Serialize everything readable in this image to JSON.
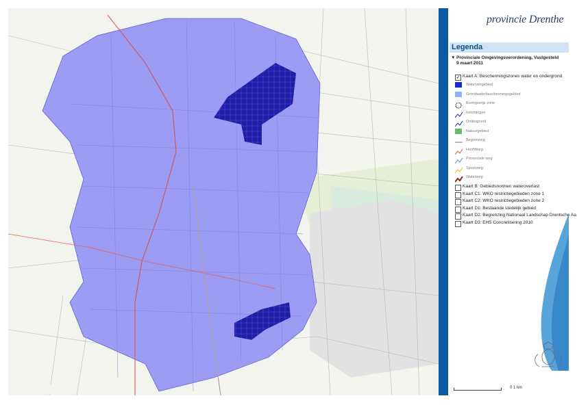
{
  "map": {
    "area_color": "#9c9cf5",
    "area_stroke": "#6060cc",
    "hatch_color": "#1e1ea6",
    "road_color": "#e04a3a"
  },
  "sidebar": {
    "logo_text": "provincie Drenthe",
    "legend_title": "Legenda",
    "group_title": "Provinciale Omgevingsverordening, Vastgesteld 9 maart 2011",
    "active_layer": "Kaart A: Beschermingszones water en ondergrond",
    "legend_items": [
      {
        "label": "Waterwingebied",
        "symbol": "fill",
        "color": "#1a2ac6"
      },
      {
        "label": "Grondwaterbeschermingsgebied",
        "symbol": "fill",
        "color": "#8fb2f2"
      },
      {
        "label": "Boringsvrije zone",
        "symbol": "dashed-circle",
        "color": "#000000"
      },
      {
        "label": "Inrichtingen",
        "symbol": "zigzag",
        "color": "#1b2a8a"
      },
      {
        "label": "Ondergrond",
        "symbol": "zigzag",
        "color": "#1b2a8a"
      },
      {
        "label": "Natuurgebied",
        "symbol": "fill",
        "color": "#6cb86c"
      },
      {
        "label": "Begrenzing",
        "symbol": "line",
        "color": "#333333"
      },
      {
        "label": "Hoofdweg",
        "symbol": "zigzag",
        "color": "#e05030"
      },
      {
        "label": "Provinciale weg",
        "symbol": "zigzag",
        "color": "#3a8ee6"
      },
      {
        "label": "Spoorweg",
        "symbol": "zigzag",
        "color": "#f0b020"
      },
      {
        "label": "Waterweg",
        "symbol": "zigzag-thick",
        "color": "#8a2a20"
      }
    ],
    "layers": [
      {
        "label": "Kaart B: Gebiedsnormen wateroverlast"
      },
      {
        "label": "Kaart C1: WKO restrictiegebieden zone 1"
      },
      {
        "label": "Kaart C2: WKO restrictiegebieden zone 2"
      },
      {
        "label": "Kaart D1: Bestaande stedelijk gebied"
      },
      {
        "label": "Kaart D2: Begrenzing Nationaal Landschap Drentsche Aa"
      },
      {
        "label": "Kaart D3: EHS Concretisering 2010"
      }
    ],
    "scale_label": "0    1 km"
  }
}
